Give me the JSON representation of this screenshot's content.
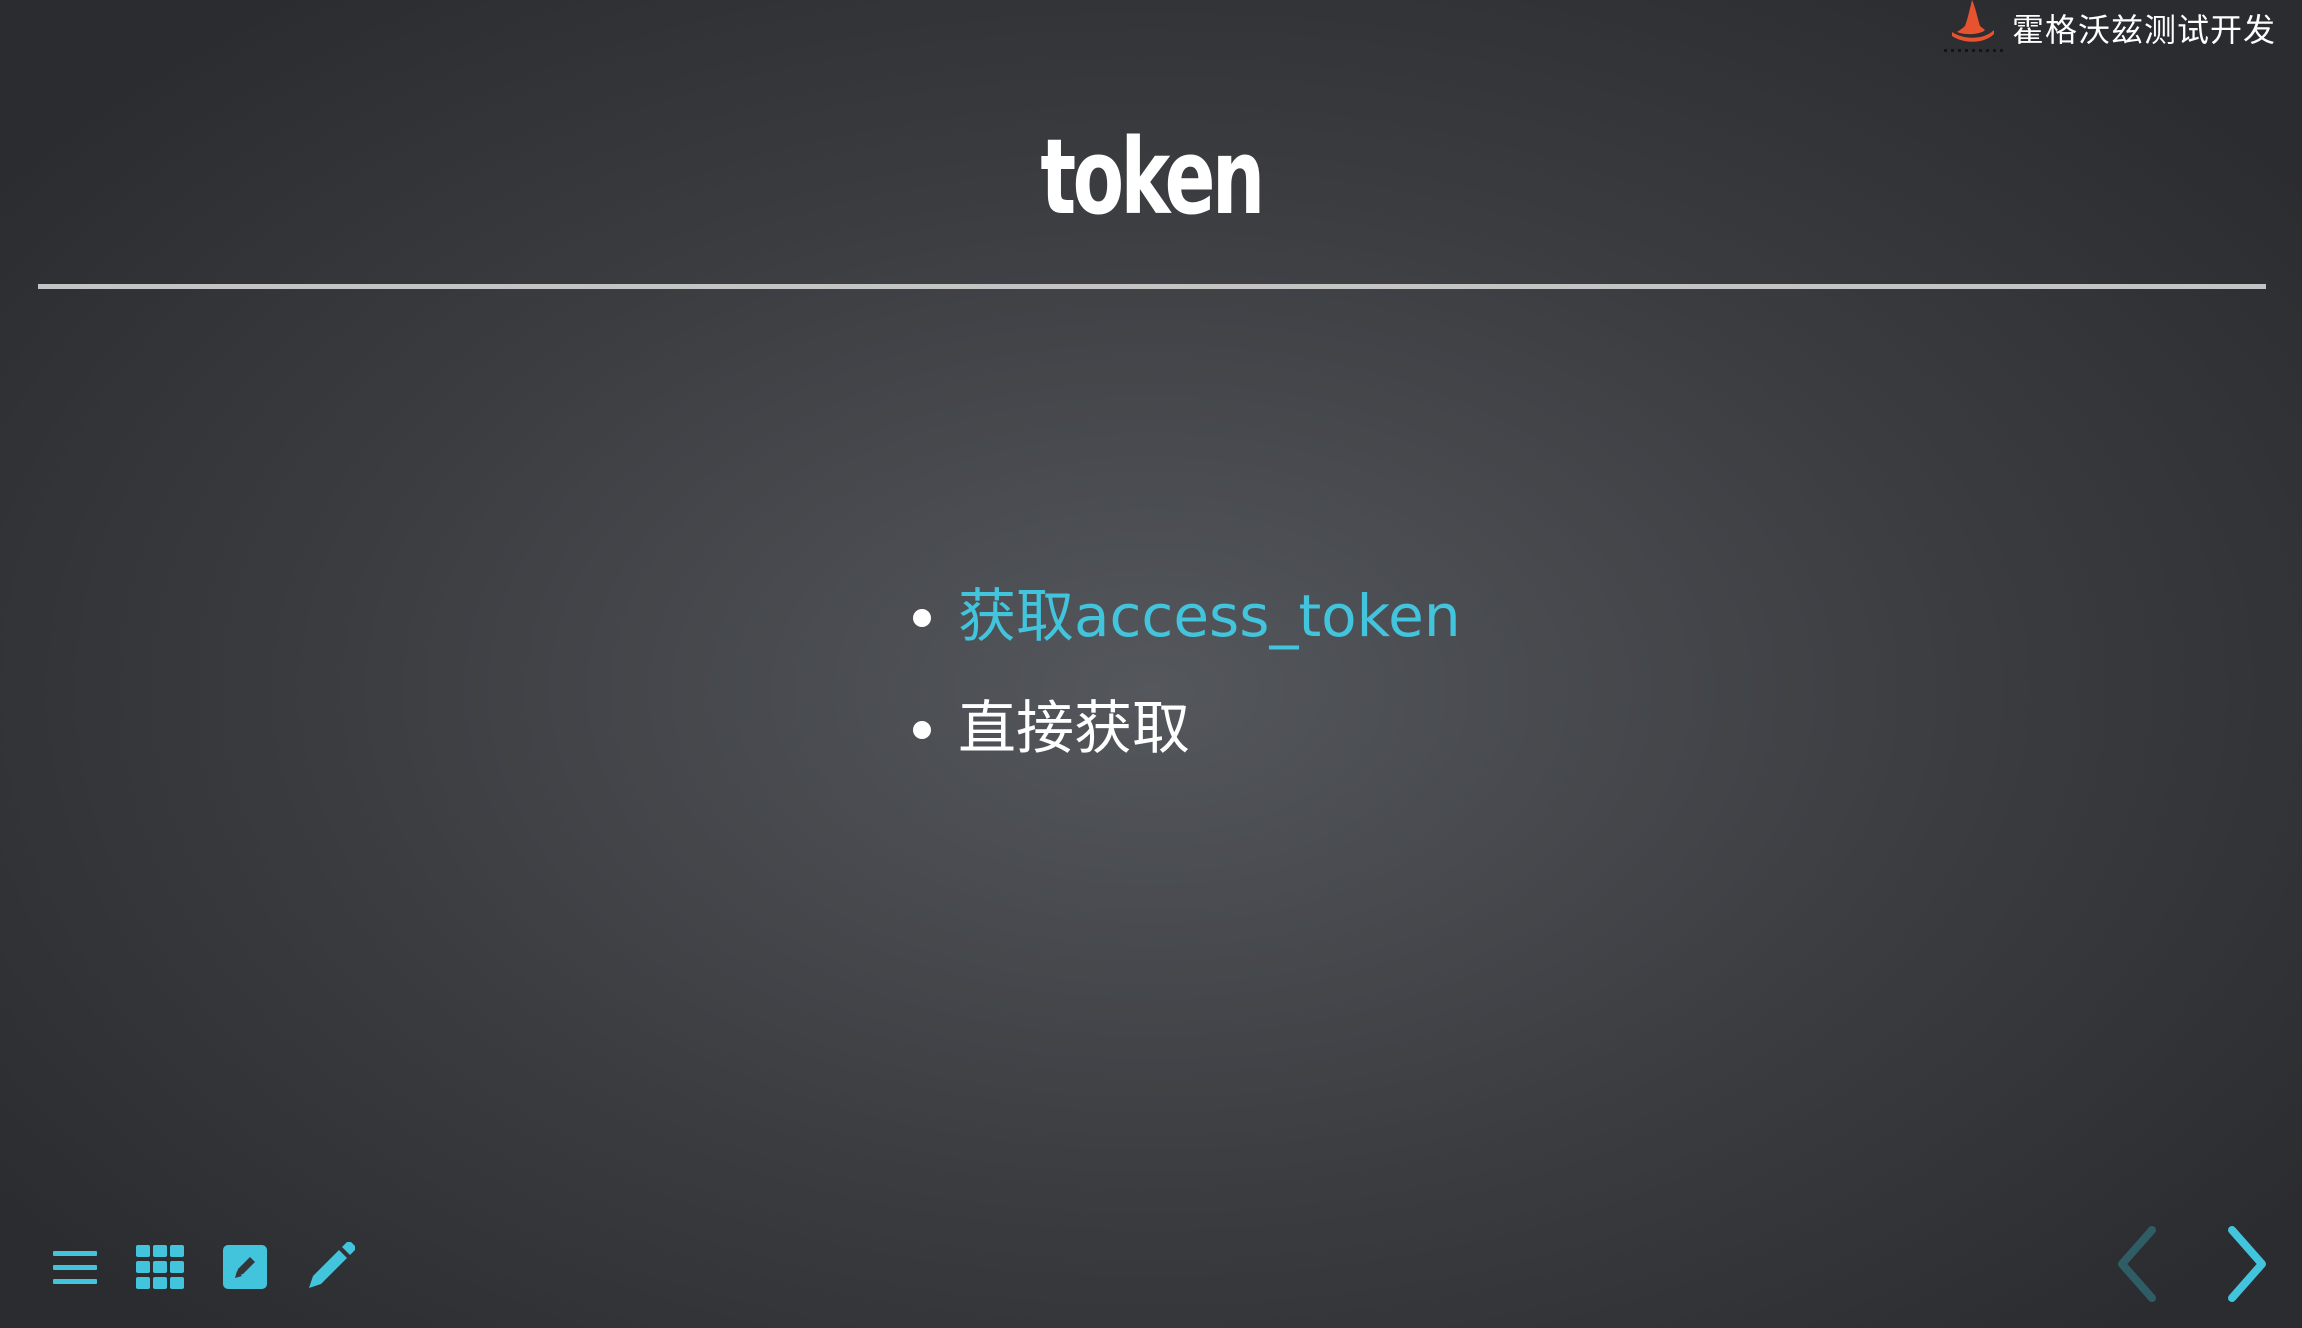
{
  "colors": {
    "accent": "#42c4dd",
    "text": "#ffffff",
    "rule": "#c4c4c4",
    "logo": "#e8532f",
    "arrow_disabled": "#2f5d66"
  },
  "header": {
    "logo_icon": "wizard-hat-icon",
    "logo_text": "霍格沃兹测试开发"
  },
  "slide": {
    "title": "token",
    "bullets": [
      {
        "text": "获取access_token",
        "is_link": true
      },
      {
        "text": "直接获取",
        "is_link": false
      }
    ]
  },
  "toolbar": {
    "icons": [
      "menu-icon",
      "grid-icon",
      "edit-note-icon",
      "pencil-icon"
    ]
  },
  "navigation": {
    "prev_icon": "chevron-left-icon",
    "next_icon": "chevron-right-icon",
    "prev_enabled": false,
    "next_enabled": true
  }
}
